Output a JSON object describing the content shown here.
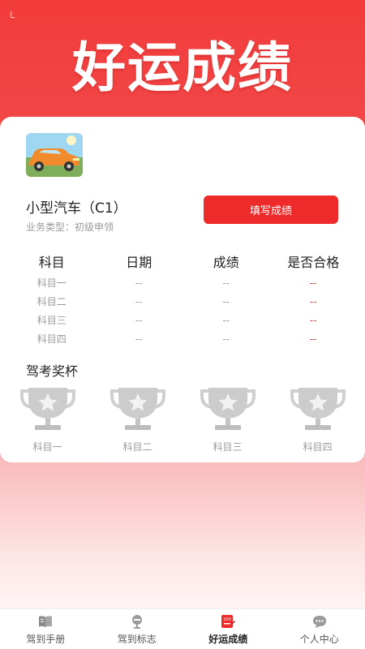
{
  "status_mark": "L",
  "hero": {
    "title": "好运成绩"
  },
  "vehicle": {
    "name": "小型汽车（C1）",
    "business_type": "业务类型：初级申领",
    "fill_button_label": "填写成绩"
  },
  "table": {
    "headers": [
      "科目",
      "日期",
      "成绩",
      "是否合格"
    ],
    "rows": [
      [
        "科目一",
        "--",
        "--",
        "--"
      ],
      [
        "科目二",
        "--",
        "--",
        "--"
      ],
      [
        "科目三",
        "--",
        "--",
        "--"
      ],
      [
        "科目四",
        "--",
        "--",
        "--"
      ]
    ]
  },
  "trophies": {
    "title": "驾考奖杯",
    "items": [
      "科目一",
      "科目二",
      "科目三",
      "科目四"
    ]
  },
  "tabbar": {
    "items": [
      {
        "label": "驾到手册",
        "icon": "book-icon"
      },
      {
        "label": "驾到标志",
        "icon": "sign-icon"
      },
      {
        "label": "好运成绩",
        "icon": "score-icon",
        "active": true
      },
      {
        "label": "个人中心",
        "icon": "chat-icon"
      }
    ]
  },
  "colors": {
    "accent": "#ee2a2a",
    "fail_red": "#e04040",
    "muted": "#9a9a9a",
    "trophy_gray": "#cccccc"
  }
}
